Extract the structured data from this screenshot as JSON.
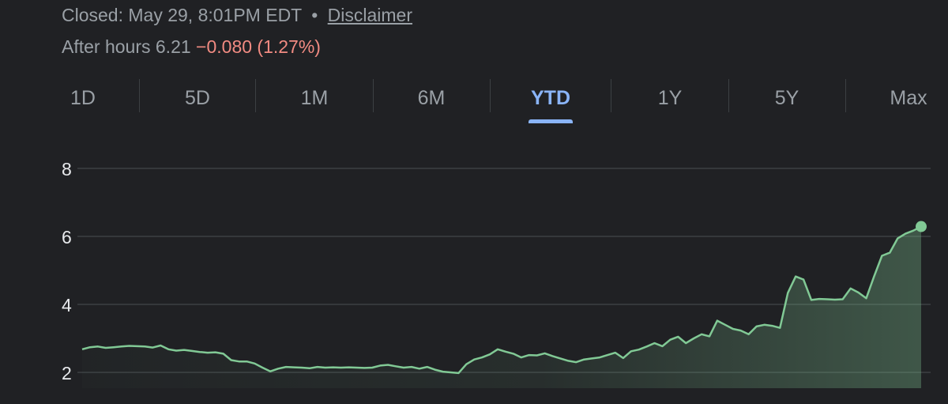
{
  "header": {
    "closed_text": "Closed: May 29, 8:01PM EDT",
    "separator": "•",
    "disclaimer_label": "Disclaimer",
    "after_hours_label": "After hours 6.21",
    "after_hours_change": "−0.080 (1.27%)"
  },
  "tabs": [
    {
      "label": "1D",
      "active": false
    },
    {
      "label": "5D",
      "active": false
    },
    {
      "label": "1M",
      "active": false
    },
    {
      "label": "6M",
      "active": false
    },
    {
      "label": "YTD",
      "active": true
    },
    {
      "label": "1Y",
      "active": false
    },
    {
      "label": "5Y",
      "active": false
    },
    {
      "label": "Max",
      "active": false
    }
  ],
  "colors": {
    "background": "#202124",
    "line": "#81c995",
    "negative": "#f28b82",
    "accent": "#8ab4f8",
    "gridline": "#3c4043"
  },
  "chart_data": {
    "type": "area",
    "ylim": [
      2,
      8
    ],
    "yticks": [
      "8",
      "6",
      "4",
      "2"
    ],
    "grid": true,
    "values": [
      2.68,
      2.74,
      2.76,
      2.72,
      2.74,
      2.76,
      2.78,
      2.77,
      2.76,
      2.73,
      2.79,
      2.68,
      2.64,
      2.66,
      2.63,
      2.6,
      2.58,
      2.59,
      2.55,
      2.36,
      2.32,
      2.32,
      2.26,
      2.14,
      2.03,
      2.11,
      2.16,
      2.15,
      2.14,
      2.12,
      2.16,
      2.14,
      2.15,
      2.14,
      2.15,
      2.14,
      2.13,
      2.14,
      2.2,
      2.22,
      2.18,
      2.14,
      2.16,
      2.11,
      2.16,
      2.08,
      2.02,
      2.0,
      1.98,
      2.24,
      2.38,
      2.44,
      2.53,
      2.68,
      2.61,
      2.55,
      2.44,
      2.51,
      2.5,
      2.56,
      2.48,
      2.41,
      2.34,
      2.3,
      2.38,
      2.41,
      2.44,
      2.51,
      2.58,
      2.42,
      2.62,
      2.67,
      2.76,
      2.86,
      2.77,
      2.96,
      3.05,
      2.86,
      3.0,
      3.12,
      3.06,
      3.52,
      3.4,
      3.28,
      3.23,
      3.12,
      3.35,
      3.4,
      3.37,
      3.31,
      4.34,
      4.82,
      4.73,
      4.13,
      4.16,
      4.15,
      4.14,
      4.15,
      4.47,
      4.35,
      4.18,
      4.82,
      5.43,
      5.52,
      5.94,
      6.08,
      6.17,
      6.29
    ]
  }
}
